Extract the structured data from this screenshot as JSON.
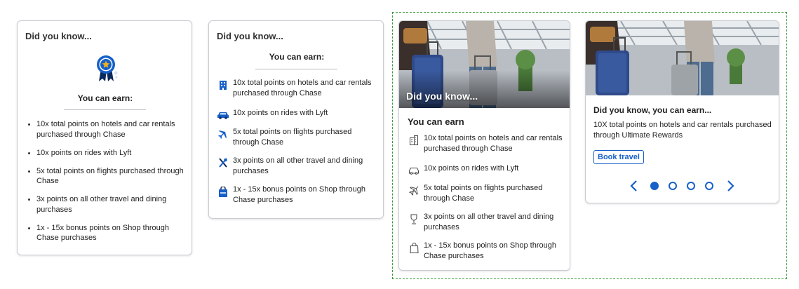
{
  "card1": {
    "title": "Did you know...",
    "earn_heading": "You can earn:",
    "items": [
      "10x total points on hotels and car rentals purchased through Chase",
      "10x points on rides with Lyft",
      "5x total points on flights purchased through Chase",
      "3x points on all other travel and dining purchases",
      "1x - 15x bonus points on Shop through Chase purchases"
    ]
  },
  "card2": {
    "title": "Did you know...",
    "earn_heading": "You can earn:",
    "items": [
      "10x total points on hotels and car rentals purchased through Chase",
      "10x points on rides with Lyft",
      "5x total points on flights purchased through Chase",
      "3x points on all other travel and dining purchases",
      "1x - 15x bonus points on Shop through Chase purchases"
    ],
    "icons": [
      "hotel-icon",
      "car-icon",
      "airplane-icon",
      "dining-icon",
      "shopping-bag-icon"
    ]
  },
  "card3": {
    "photo_caption": "Did you know...",
    "earn_heading": "You can earn",
    "items": [
      "10x total points on hotels and car rentals purchased through Chase",
      "10x points on rides with Lyft",
      "5x total points on flights purchased through Chase",
      "3x points on all other travel and dining purchases",
      "1x - 15x bonus points on Shop through Chase purchases"
    ],
    "icons": [
      "building-icon",
      "car-icon",
      "airplane-icon",
      "wine-glass-icon",
      "shopping-bag-icon"
    ]
  },
  "card4": {
    "heading": "Did you know, you can earn...",
    "body": "10X total points on hotels and car rentals purchased through Ultimate Rewards",
    "button_label": "Book travel",
    "carousel": {
      "total": 4,
      "active_index": 0
    }
  },
  "colors": {
    "accent": "#1660c8",
    "selection_border": "#3a9a3a"
  }
}
